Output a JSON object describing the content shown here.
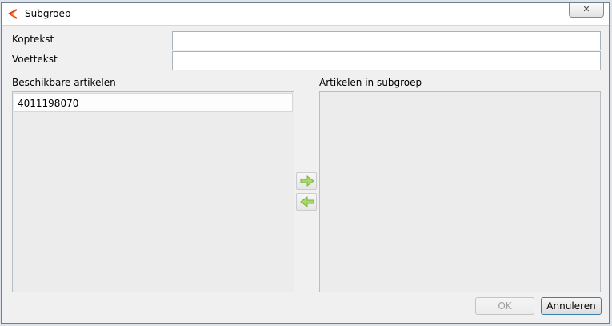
{
  "window": {
    "title": "Subgroep",
    "close_symbol": "✕"
  },
  "form": {
    "koptekst_label": "Koptekst",
    "koptekst_value": "",
    "voettekst_label": "Voettekst",
    "voettekst_value": ""
  },
  "available": {
    "label": "Beschikbare artikelen",
    "items": [
      "4011198070"
    ]
  },
  "subgroup": {
    "label": "Artikelen in subgroep",
    "items": []
  },
  "transfer": {
    "add_icon": "arrow-right-icon",
    "remove_icon": "arrow-left-icon"
  },
  "buttons": {
    "ok": "OK",
    "cancel": "Annuleren"
  },
  "colors": {
    "arrow": "#8cc63f",
    "app_icon": "#d9381e"
  }
}
